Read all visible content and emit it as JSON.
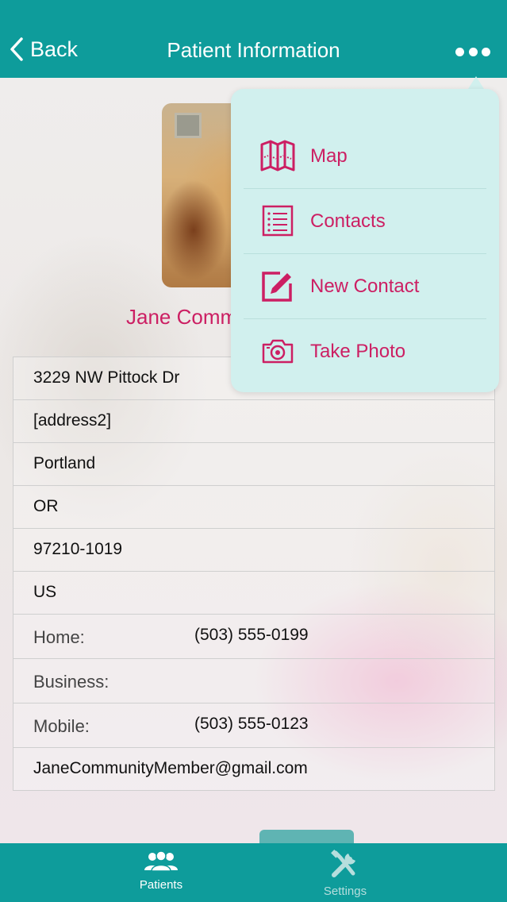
{
  "nav": {
    "back_label": "Back",
    "title": "Patient Information"
  },
  "patient": {
    "name": "Jane Comm",
    "address1": "3229 NW Pittock Dr",
    "address2": "[address2]",
    "city": "Portland",
    "state": "OR",
    "zip": "97210-1019",
    "country": "US",
    "phones": [
      {
        "label": "Home:",
        "value": "(503) 555-0199"
      },
      {
        "label": "Business:",
        "value": ""
      },
      {
        "label": "Mobile:",
        "value": "(503) 555-0123"
      }
    ],
    "email": "JaneCommunityMember@gmail.com"
  },
  "menu": {
    "items": [
      {
        "label": "Map",
        "icon": "map-icon"
      },
      {
        "label": "Contacts",
        "icon": "list-icon"
      },
      {
        "label": "New Contact",
        "icon": "edit-icon"
      },
      {
        "label": "Take Photo",
        "icon": "camera-icon"
      }
    ]
  },
  "tabs": [
    {
      "label": "Patients",
      "icon": "people-icon",
      "active": true
    },
    {
      "label": "Settings",
      "icon": "tools-icon",
      "active": false
    }
  ],
  "colors": {
    "primary": "#0e9c9b",
    "accent": "#cc1f63",
    "menu_bg": "#d1f0ee"
  }
}
